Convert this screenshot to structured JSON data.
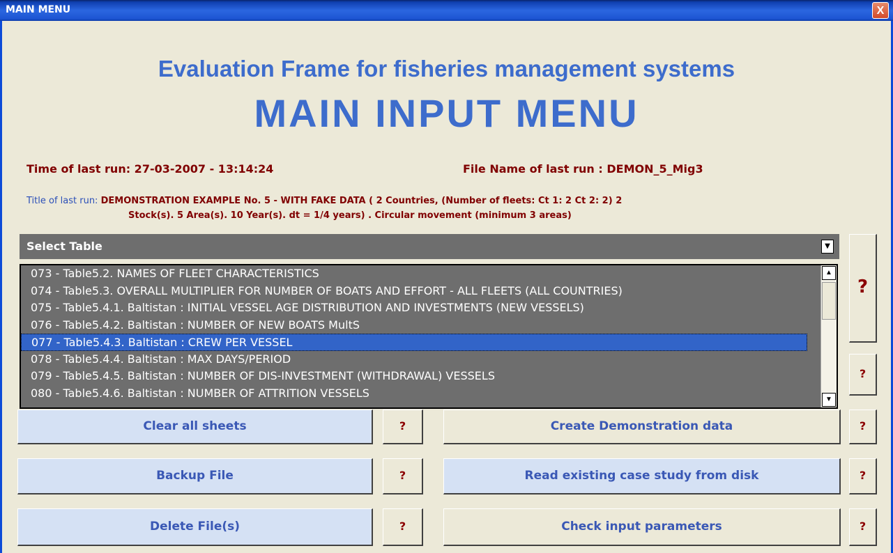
{
  "window": {
    "title": "MAIN MENU",
    "close_label": "X"
  },
  "header": {
    "title": "Evaluation Frame for fisheries management systems",
    "subtitle": "MAIN INPUT MENU"
  },
  "run_info": {
    "time_label": "Time of last run: 27-03-2007 - 13:14:24",
    "file_label": "File Name of last run : DEMON_5_Mig3",
    "title_prefix": "Title of last run:",
    "title_line1": "DEMONSTRATION EXAMPLE No. 5 -  WITH FAKE DATA ( 2 Countries, (Number of fleets:  Ct 1: 2  Ct 2: 2)  2",
    "title_line2": "Stock(s).  5 Area(s).  10 Year(s).   dt = 1/4 years) . Circular movement (minimum 3 areas)"
  },
  "select_table": {
    "label": "Select Table",
    "arrow": "▼"
  },
  "table_list": {
    "items": [
      "073 - Table5.2. NAMES OF FLEET CHARACTERISTICS",
      "074 - Table5.3. OVERALL MULTIPLIER FOR NUMBER OF BOATS AND EFFORT - ALL FLEETS (ALL COUNTRIES)",
      "075 - Table5.4.1. Baltistan :  INITIAL VESSEL AGE DISTRIBUTION AND INVESTMENTS (NEW VESSELS)",
      "076 - Table5.4.2. Baltistan :   NUMBER OF NEW BOATS MultS",
      "077 - Table5.4.3. Baltistan :   CREW PER VESSEL",
      "078 - Table5.4.4. Baltistan :   MAX DAYS/PERIOD",
      "079 - Table5.4.5. Baltistan :  NUMBER OF DIS-INVESTMENT (WITHDRAWAL) VESSELS",
      "080 - Table5.4.6. Baltistan :   NUMBER OF ATTRITION VESSELS"
    ],
    "selected_index": 4,
    "scroll_up": "▲",
    "scroll_down": "▼"
  },
  "help": {
    "label": "?"
  },
  "buttons": {
    "clear_all": "Clear all sheets",
    "create_demo": "Create Demonstration data",
    "backup": "Backup File",
    "read_case": "Read existing case study from disk",
    "delete": "Delete  File(s)",
    "check_params": "Check input parameters"
  }
}
